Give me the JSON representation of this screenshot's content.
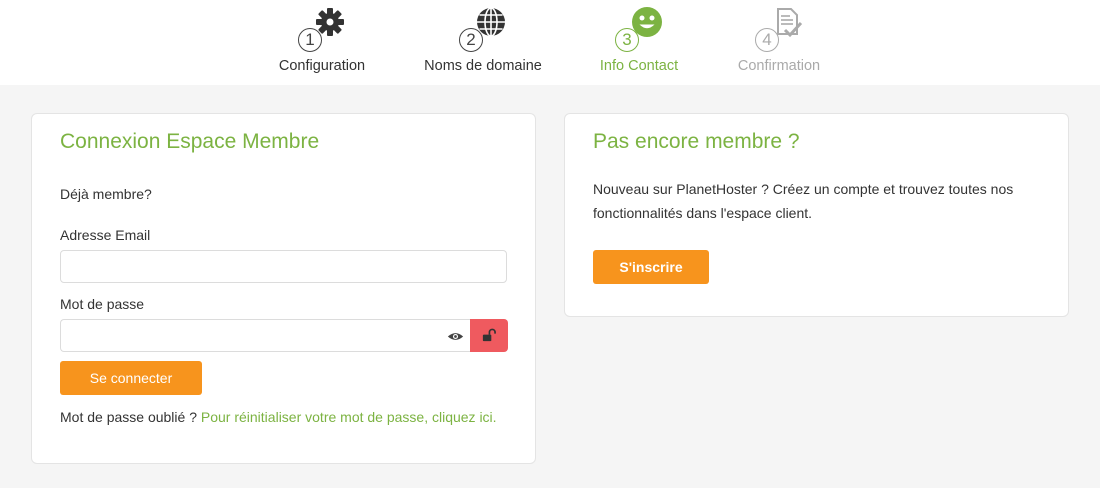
{
  "stepper": {
    "steps": [
      {
        "number": "1",
        "label": "Configuration",
        "icon": "gear-icon",
        "state": "done"
      },
      {
        "number": "2",
        "label": "Noms de domaine",
        "icon": "globe-icon",
        "state": "done"
      },
      {
        "number": "3",
        "label": "Info Contact",
        "icon": "smiley-icon",
        "state": "active"
      },
      {
        "number": "4",
        "label": "Confirmation",
        "icon": "document-check-icon",
        "state": "future"
      }
    ]
  },
  "login": {
    "title": "Connexion Espace Membre",
    "already_member": "Déjà membre?",
    "email_label": "Adresse Email",
    "email_value": "",
    "password_label": "Mot de passe",
    "password_value": "",
    "submit_label": "Se connecter",
    "forgot_text": "Mot de passe oublié ?",
    "reset_link": "Pour réinitialiser votre mot de passe, cliquez ici."
  },
  "signup": {
    "title": "Pas encore membre ?",
    "description": "Nouveau sur PlanetHoster ? Créez un compte et trouvez toutes nos fonctionnalités dans l'espace client.",
    "button_label": "S'inscrire"
  },
  "colors": {
    "accent_green": "#7cb342",
    "button_orange": "#f7941d",
    "unlock_red": "#ef5a5f",
    "background": "#f5f5f5"
  }
}
